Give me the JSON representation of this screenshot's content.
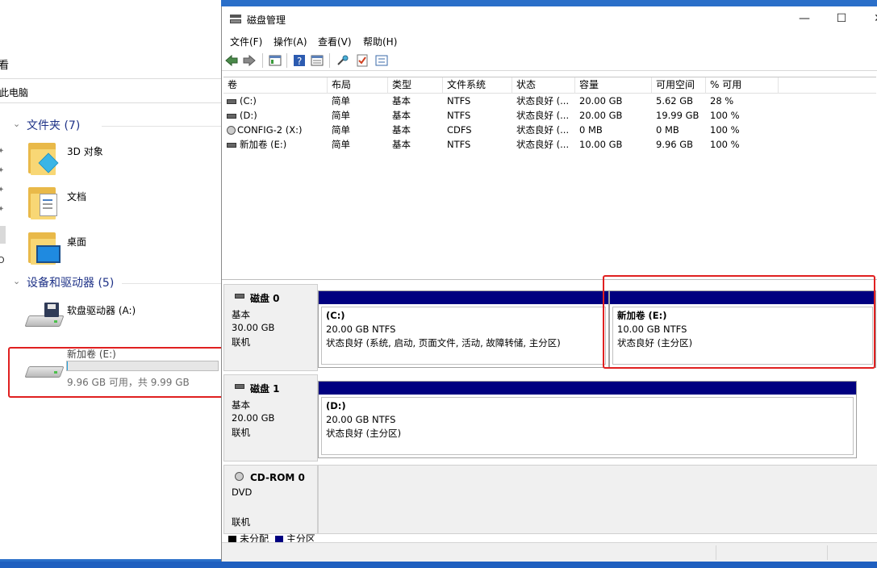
{
  "explorer": {
    "ribbon_tab": "看",
    "address": "此电脑",
    "folders_group": "文件夹 (7)",
    "devices_group": "设备和驱动器 (5)",
    "folders": [
      {
        "label": "3D 对象",
        "icon": "3d-objects-folder-icon"
      },
      {
        "label": "文档",
        "icon": "documents-folder-icon"
      },
      {
        "label": "桌面",
        "icon": "desktop-folder-icon"
      }
    ],
    "devices": [
      {
        "label": "软盘驱动器 (A:)",
        "icon": "floppy-drive-icon"
      },
      {
        "label": "新加卷 (E:)",
        "icon": "hard-drive-icon",
        "capacity_text": "9.96 GB 可用，共 9.99 GB",
        "used_fraction": 0.003
      }
    ],
    "colors": {
      "group_title": "#1e3287",
      "capacity_fill": "#26a0da",
      "highlight": "#e02020"
    }
  },
  "disk_mgmt": {
    "title": "磁盘管理",
    "controls": {
      "minimize": "—",
      "maximize": "☐",
      "close": "✕"
    },
    "menu": [
      "文件(F)",
      "操作(A)",
      "查看(V)",
      "帮助(H)"
    ],
    "toolbar_icons": [
      "back-icon",
      "forward-icon",
      "console-tree-icon",
      "help-icon",
      "properties-icon",
      "connect-icon",
      "check-icon",
      "list-icon"
    ],
    "columns": [
      "卷",
      "布局",
      "类型",
      "文件系统",
      "状态",
      "容量",
      "可用空间",
      "% 可用"
    ],
    "volumes": [
      {
        "name": "(C:)",
        "layout": "简单",
        "type": "基本",
        "fs": "NTFS",
        "status": "状态良好 (...",
        "capacity": "20.00 GB",
        "free": "5.62 GB",
        "pct": "28 %"
      },
      {
        "name": "(D:)",
        "layout": "简单",
        "type": "基本",
        "fs": "NTFS",
        "status": "状态良好 (...",
        "capacity": "20.00 GB",
        "free": "19.99 GB",
        "pct": "100 %"
      },
      {
        "name": "CONFIG-2 (X:)",
        "layout": "简单",
        "type": "基本",
        "fs": "CDFS",
        "status": "状态良好 (...",
        "capacity": "0 MB",
        "free": "0 MB",
        "pct": "100 %"
      },
      {
        "name": "新加卷 (E:)",
        "layout": "简单",
        "type": "基本",
        "fs": "NTFS",
        "status": "状态良好 (...",
        "capacity": "10.00 GB",
        "free": "9.96 GB",
        "pct": "100 %"
      }
    ],
    "disks": [
      {
        "name": "磁盘 0",
        "kind": "基本",
        "size": "30.00 GB",
        "state": "联机",
        "partitions": [
          {
            "name": "(C:)",
            "size": "20.00 GB NTFS",
            "status": "状态良好 (系统, 启动, 页面文件, 活动, 故障转储, 主分区)"
          },
          {
            "name": "新加卷  (E:)",
            "size": "10.00 GB NTFS",
            "status": "状态良好 (主分区)"
          }
        ]
      },
      {
        "name": "磁盘 1",
        "kind": "基本",
        "size": "20.00 GB",
        "state": "联机",
        "partitions": [
          {
            "name": "(D:)",
            "size": "20.00 GB NTFS",
            "status": "状态良好 (主分区)"
          }
        ]
      },
      {
        "name": "CD-ROM 0",
        "kind": "DVD",
        "size": "",
        "state": "联机",
        "partitions": []
      }
    ],
    "legend": [
      {
        "label": "未分配",
        "color": "#000000"
      },
      {
        "label": "主分区",
        "color": "#000080"
      }
    ]
  }
}
